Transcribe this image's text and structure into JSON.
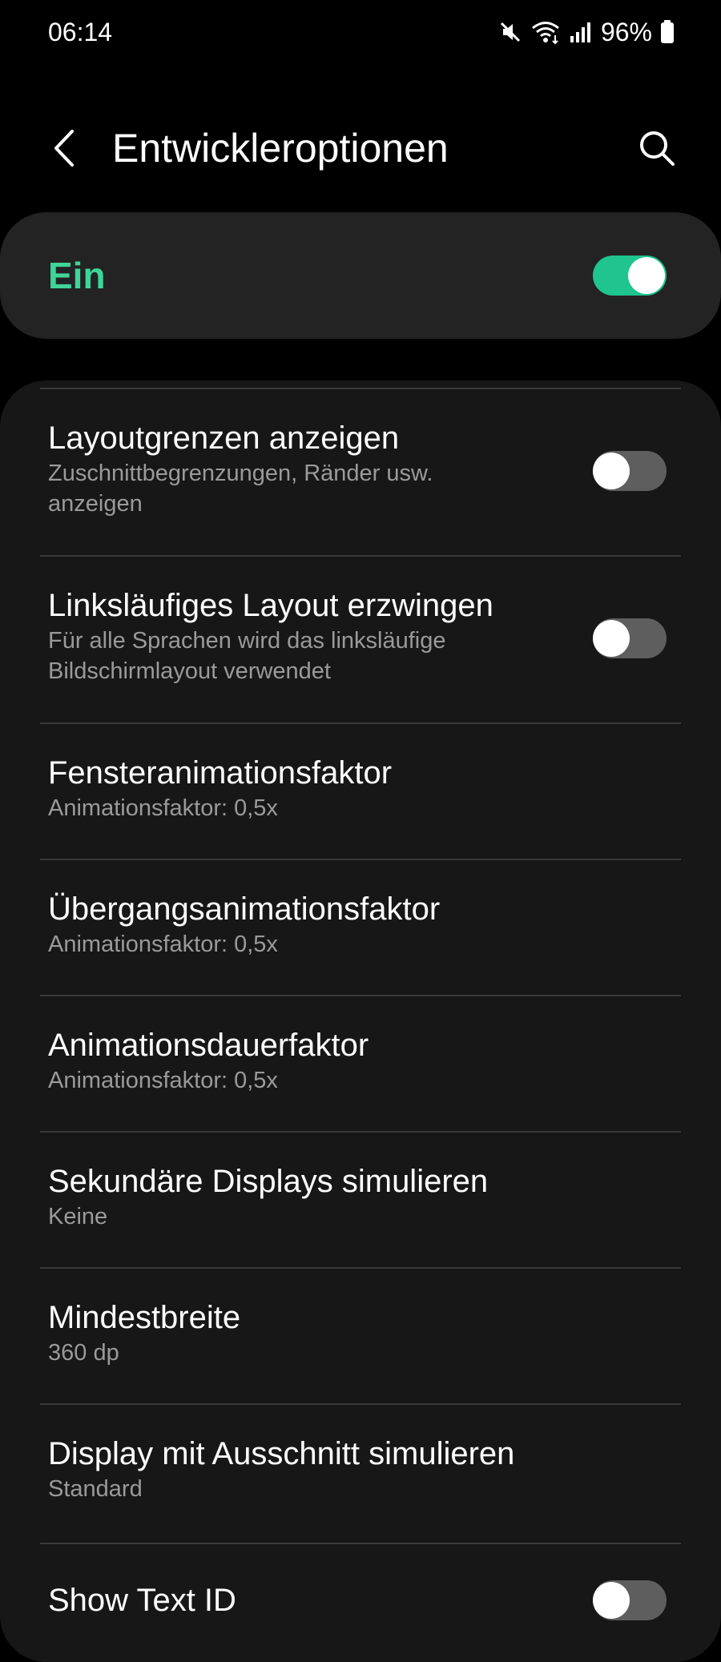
{
  "status_bar": {
    "time": "06:14",
    "battery_level": "96%",
    "icons": [
      "mute-icon",
      "wifi-icon",
      "signal-icon",
      "battery-icon"
    ]
  },
  "header": {
    "title": "Entwickleroptionen",
    "back_icon": "back-arrow-icon",
    "search_icon": "search-icon"
  },
  "master_switch": {
    "label": "Ein",
    "on": true
  },
  "settings": [
    {
      "title": "Layoutgrenzen anzeigen",
      "summary": "Zuschnittbegrenzungen, Ränder usw. anzeigen",
      "toggle": false
    },
    {
      "title": "Linksläufiges Layout erzwingen",
      "summary": "Für alle Sprachen wird das linksläufige Bildschirmlayout verwendet",
      "toggle": false
    },
    {
      "title": "Fensteranimationsfaktor",
      "summary": "Animationsfaktor: 0,5x"
    },
    {
      "title": "Übergangsanimationsfaktor",
      "summary": "Animationsfaktor: 0,5x"
    },
    {
      "title": "Animationsdauerfaktor",
      "summary": "Animationsfaktor: 0,5x"
    },
    {
      "title": "Sekundäre Displays simulieren",
      "summary": "Keine"
    },
    {
      "title": "Mindestbreite",
      "summary": "360 dp"
    },
    {
      "title": "Display mit Ausschnitt simulieren",
      "summary": "Standard"
    },
    {
      "title": "Show Text ID",
      "toggle": false
    }
  ],
  "colors": {
    "background": "#000000",
    "card": "#232323",
    "list_card": "#171717",
    "accent": "#1fc48e",
    "accent_text": "#3ed49a",
    "summary_text": "#9a9a9a",
    "toggle_off": "#5e5e5e"
  }
}
